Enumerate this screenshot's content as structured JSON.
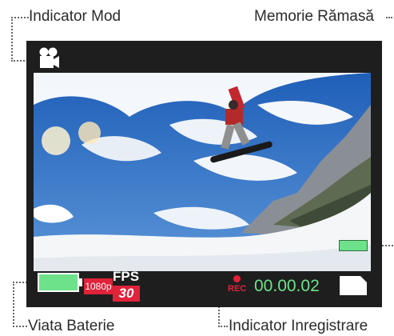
{
  "callouts": {
    "mode": "Indicator Mod",
    "memory": "Memorie Rămasă",
    "battery": "Viata Baterie",
    "recording": "Indicator Inregistrare"
  },
  "display": {
    "mode_icon": "video-camera-icon",
    "video_scene": "snowboarder-jump",
    "battery_level": 1.0,
    "memory_level": 1.0,
    "resolution": "1080p",
    "fps_label": "FPS",
    "fps_value": "30",
    "rec_label": "REC",
    "timer": "00.00.02",
    "card_icon": "memory-card-icon"
  },
  "colors": {
    "screen": "#1e1e1e",
    "accent_green": "#6de28a",
    "accent_red": "#e0223a",
    "sky": "#2f6fc4",
    "snow": "#f4f6f8"
  }
}
